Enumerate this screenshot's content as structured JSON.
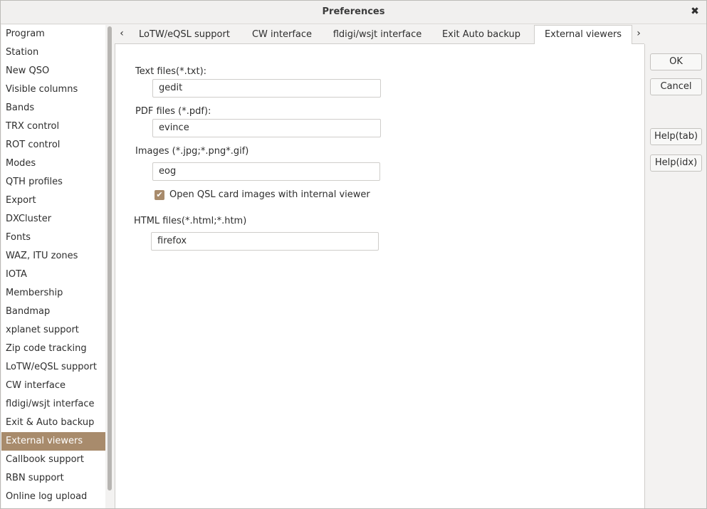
{
  "window": {
    "title": "Preferences"
  },
  "sidebar": {
    "items": [
      {
        "label": "Program"
      },
      {
        "label": "Station"
      },
      {
        "label": "New QSO"
      },
      {
        "label": "Visible columns"
      },
      {
        "label": "Bands"
      },
      {
        "label": "TRX control"
      },
      {
        "label": "ROT control"
      },
      {
        "label": "Modes"
      },
      {
        "label": "QTH profiles"
      },
      {
        "label": "Export"
      },
      {
        "label": "DXCluster"
      },
      {
        "label": "Fonts"
      },
      {
        "label": "WAZ, ITU zones"
      },
      {
        "label": "IOTA"
      },
      {
        "label": "Membership"
      },
      {
        "label": "Bandmap"
      },
      {
        "label": "xplanet support"
      },
      {
        "label": "Zip code tracking"
      },
      {
        "label": "LoTW/eQSL support"
      },
      {
        "label": "CW interface"
      },
      {
        "label": "fldigi/wsjt interface"
      },
      {
        "label": "Exit & Auto backup"
      },
      {
        "label": "External viewers"
      },
      {
        "label": "Callbook support"
      },
      {
        "label": "RBN support"
      },
      {
        "label": "Online log upload"
      }
    ],
    "selected": "External viewers"
  },
  "tabs": {
    "items": [
      {
        "label": "LoTW/eQSL support"
      },
      {
        "label": "CW interface"
      },
      {
        "label": "fldigi/wsjt interface"
      },
      {
        "label": "Exit  Auto backup"
      },
      {
        "label": "External viewers"
      }
    ],
    "active": "External viewers"
  },
  "viewers": {
    "text_label": "Text files(*.txt):",
    "text_value": "gedit",
    "pdf_label": "PDF files (*.pdf):",
    "pdf_value": "evince",
    "images_label": "Images (*.jpg;*.png*.gif)",
    "images_value": "eog",
    "qsl_checkbox_label": "Open QSL card images with internal viewer",
    "qsl_checked": true,
    "html_label": "HTML files(*.html;*.htm)",
    "html_value": "firefox"
  },
  "buttons": {
    "ok": "OK",
    "cancel": "Cancel",
    "help_tab": "Help(tab)",
    "help_idx": "Help(idx)"
  },
  "colors": {
    "accent": "#a88b6c",
    "background": "#f3f2f1",
    "panel": "#ffffff"
  },
  "icons": {
    "close": "close-icon",
    "tab_left": "chevron-left-icon",
    "tab_right": "chevron-right-icon",
    "check": "check-icon"
  }
}
